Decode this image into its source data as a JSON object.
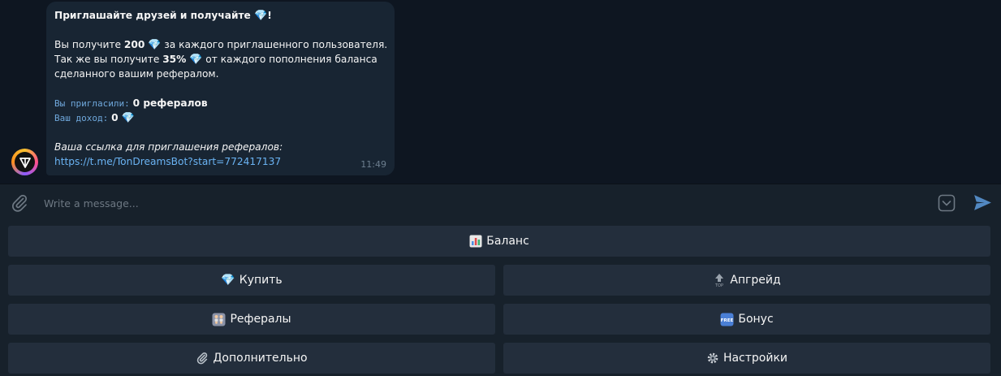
{
  "message": {
    "title": "Приглашайте друзей и получайте",
    "title_suffix": "!",
    "line1_pre": "Вы получите ",
    "line1_bold": "200",
    "line1_post": " за каждого приглашенного пользователя.",
    "line2_pre": "Так же вы получите ",
    "line2_bold": "35%",
    "line2_post": " от каждого пополнения баланса",
    "line3": "сделанного вашим рефералом.",
    "invited_label": "Вы пригласили:",
    "invited_value": "0 рефералов",
    "income_label": "Ваш доход:",
    "income_value": "0",
    "link_label": "Ваша ссылка для приглашения рефералов:",
    "link_url": "https://t.me/TonDreamsBot?start=772417137",
    "time": "11:49"
  },
  "composer": {
    "placeholder": "Write a message..."
  },
  "keyboard": {
    "balance": "Баланс",
    "buy": "Купить",
    "upgrade": "Апгрейд",
    "referrals": "Рефералы",
    "bonus": "Бонус",
    "extra": "Дополнительно",
    "settings": "Настройки"
  },
  "colors": {
    "chat_bg": "#0e1621",
    "bubble_bg": "#182533",
    "panel_bg": "#17212b",
    "button_bg": "#232e3c",
    "link": "#6ab3f3",
    "send": "#5288c1"
  },
  "icons": [
    "gem-icon",
    "paperclip-icon",
    "keyboard-icon",
    "send-icon",
    "chart-icon",
    "top-arrow-icon",
    "family-icon",
    "free-icon",
    "gear-icon"
  ]
}
